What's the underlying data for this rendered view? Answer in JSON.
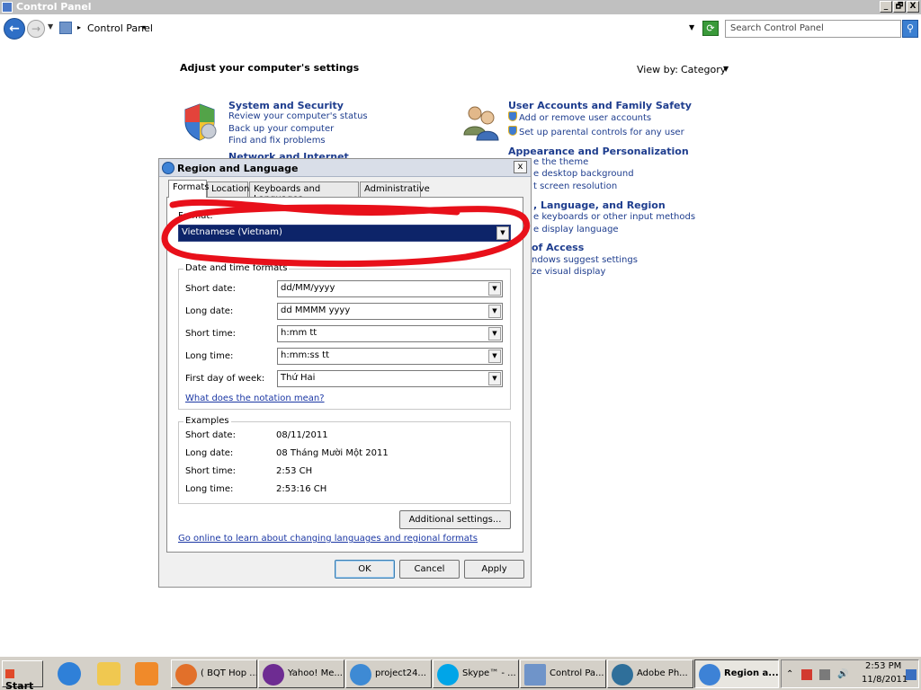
{
  "window": {
    "title": "Control Panel",
    "buttons": [
      "_",
      "🗗",
      "X"
    ]
  },
  "address": {
    "breadcrumb": "Control Panel",
    "search_placeholder": "Search Control Panel"
  },
  "control_panel": {
    "heading": "Adjust your computer's settings",
    "view_by_label": "View by:",
    "view_by_value": "Category",
    "categories": [
      {
        "title": "System and Security",
        "links": [
          "Review your computer's status",
          "Back up your computer",
          "Find and fix problems"
        ]
      },
      {
        "title": "Network and Internet",
        "links": []
      },
      {
        "title": "User Accounts and Family Safety",
        "links": [
          "Add or remove user accounts",
          "Set up parental controls for any user"
        ]
      },
      {
        "title": "Appearance and Personalization",
        "links": [
          "e the theme",
          "e desktop background",
          "t screen resolution"
        ]
      },
      {
        "title": ", Language, and Region",
        "links": [
          "e keyboards or other input methods",
          "e display language"
        ]
      },
      {
        "title": "of Access",
        "links": [
          "ndows suggest settings",
          "ze visual display"
        ]
      }
    ]
  },
  "dialog": {
    "title": "Region and Language",
    "close": "x",
    "tabs": [
      "Formats",
      "Location",
      "Keyboards and Languages",
      "Administrative"
    ],
    "format_label": "Format:",
    "format_value": "Vietnamese (Vietnam)",
    "date_time_group": "Date and time formats",
    "fields": [
      {
        "label": "Short date:",
        "value": "dd/MM/yyyy"
      },
      {
        "label": "Long date:",
        "value": "dd MMMM yyyy"
      },
      {
        "label": "Short time:",
        "value": "h:mm tt"
      },
      {
        "label": "Long time:",
        "value": "h:mm:ss tt"
      },
      {
        "label": "First day of week:",
        "value": "Thứ Hai"
      }
    ],
    "notation_link": "What does the notation mean?",
    "examples_group": "Examples",
    "examples": [
      {
        "label": "Short date:",
        "value": "08/11/2011"
      },
      {
        "label": "Long date:",
        "value": "08 Tháng Mười Một 2011"
      },
      {
        "label": "Short time:",
        "value": "2:53 CH"
      },
      {
        "label": "Long time:",
        "value": "2:53:16 CH"
      }
    ],
    "additional_settings": "Additional settings...",
    "online_link": "Go online to learn about changing languages and regional formats",
    "ok": "OK",
    "cancel": "Cancel",
    "apply": "Apply"
  },
  "taskbar": {
    "start": "Start",
    "tasks": [
      "( BQT Hop ...",
      "Yahoo! Me...",
      "project24...",
      "Skype™ - ...",
      "Control Pa...",
      "Adobe Ph...",
      "Region a..."
    ],
    "time": "2:53 PM",
    "date": "11/8/2011"
  },
  "colors": {
    "link_blue": "#1e3d8e",
    "selection": "#0d2469",
    "annotation_red": "#e8101a"
  }
}
